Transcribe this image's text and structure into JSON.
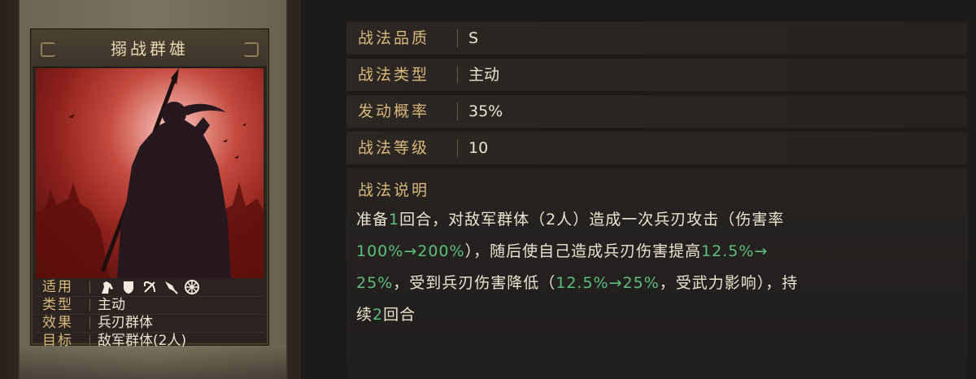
{
  "card": {
    "title": "搦战群雄",
    "attributes": [
      {
        "key": "适用",
        "troop_icons": [
          "cavalry-icon",
          "shield-icon",
          "bow-icon",
          "spear-icon",
          "chariot-icon"
        ]
      },
      {
        "key": "类型",
        "value": "主动"
      },
      {
        "key": "效果",
        "value": "兵刃群体"
      },
      {
        "key": "目标",
        "value": "敌军群体(2人)"
      }
    ]
  },
  "stats": [
    {
      "key": "战法品质",
      "value": "S"
    },
    {
      "key": "战法类型",
      "value": "主动"
    },
    {
      "key": "发动概率",
      "value": "35%"
    },
    {
      "key": "战法等级",
      "value": "10"
    }
  ],
  "description": {
    "title": "战法说明",
    "segments": [
      {
        "text": "准备"
      },
      {
        "text": "1",
        "hl": true
      },
      {
        "text": "回合，对敌军群体（2人）造成一次兵刃攻击（伤害率"
      },
      {
        "br": true
      },
      {
        "text": "100%→200%",
        "hl": true
      },
      {
        "text": "），随后使自己造成兵刃伤害提高"
      },
      {
        "text": "12.5%→",
        "hl": true
      },
      {
        "br": true
      },
      {
        "text": "25%",
        "hl": true
      },
      {
        "text": "，受到兵刃伤害降低（"
      },
      {
        "text": "12.5%→25%",
        "hl": true
      },
      {
        "text": "，受武力影响），持"
      },
      {
        "br": true
      },
      {
        "text": "续"
      },
      {
        "text": "2",
        "hl": true
      },
      {
        "text": "回合"
      }
    ]
  },
  "colors": {
    "label": "#d7b97c",
    "value": "#ece4d2",
    "highlight": "#5dbf7e"
  }
}
